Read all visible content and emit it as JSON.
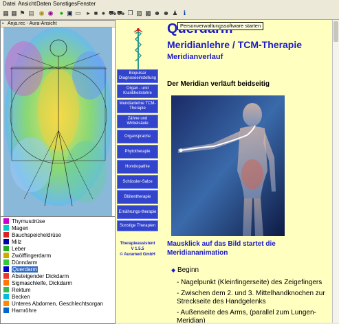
{
  "menu": [
    "Datei",
    "Ansicht",
    "Daten",
    "Sonstiges",
    "Fenster"
  ],
  "toolbar": {
    "icons": [
      "grid-icon",
      "grid-icon",
      "flag-icon",
      "chart-icon",
      "globe-icon",
      "globe-icon",
      "record-icon",
      "save-icon",
      "print-icon",
      "play-icon",
      "stop-icon",
      "step-icon",
      "car-icon",
      "car-icon",
      "copy-icon",
      "image-icon",
      "person-icon",
      "person-icon",
      "person-icon",
      "info-icon"
    ],
    "tooltip": "Personverwaltungssoftware starten"
  },
  "left_window": {
    "title": "Anja.rec  -  Aura-Ansicht"
  },
  "meridian_list": [
    {
      "label": "Thymusdrüse",
      "color": "#cc00cc"
    },
    {
      "label": "Magen",
      "color": "#00cccc"
    },
    {
      "label": "Bauchspeicheldrüse",
      "color": "#dd2222"
    },
    {
      "label": "Milz",
      "color": "#0000aa"
    },
    {
      "label": "Leber",
      "color": "#22aa22"
    },
    {
      "label": "Zwölffingerdarm",
      "color": "#ccaa00"
    },
    {
      "label": "Dünndarm",
      "color": "#33cc33"
    },
    {
      "label": "Querdarm",
      "color": "#0000cc",
      "selected": true
    },
    {
      "label": "Absteigender Dickdarm",
      "color": "#ee3333"
    },
    {
      "label": "Sigmaschleife, Dickdarm",
      "color": "#ff7700"
    },
    {
      "label": "Rektum",
      "color": "#33bb55"
    },
    {
      "label": "Becken",
      "color": "#00bbdd"
    },
    {
      "label": "Unteres Abdomen, Geschlechtsorgan",
      "color": "#ff8800"
    },
    {
      "label": "Harnröhre",
      "color": "#0066cc"
    }
  ],
  "nav": [
    "Biopulsar Diagnoseeinstellung",
    "Organ - und Krankheitslehre",
    "Meridianlehre TCM-Therapie",
    "Zähne und Wirbelsäule",
    "Organsprache",
    "Phytotherapie",
    "Homöopathie",
    "Schüssler-Salze",
    "Blütentherapie",
    "Ernährungs-therapie",
    "Sonstige Therapien"
  ],
  "app_info": {
    "name": "Therapieassistent",
    "version": "V 1.5.5",
    "copyright": "© Auramed GmbH"
  },
  "content": {
    "title": "Querdarm",
    "subtitle": "Meridianlehre / TCM-Therapie",
    "section": "Meridianverlauf",
    "note": "Der Meridian verläuft beidseitig",
    "caption": "Mausklick auf das Bild startet die Meridiananimation",
    "beginn": "Beginn",
    "points": [
      "- Nagelpunkt (Kleinfingerseite) des Zeigefingers",
      "- Zwischen dem 2. und 3. Mittelhandknochen zur",
      "  Streckseite des Handgelenks",
      "- Außenseite des Arms, (parallel zum Lungen-",
      "  Meridian)"
    ]
  },
  "colors": {
    "accent": "#1a1acc",
    "nav_bg": "#3344cc",
    "panel_bg": "#ffffc0",
    "select": "#316ac5"
  }
}
